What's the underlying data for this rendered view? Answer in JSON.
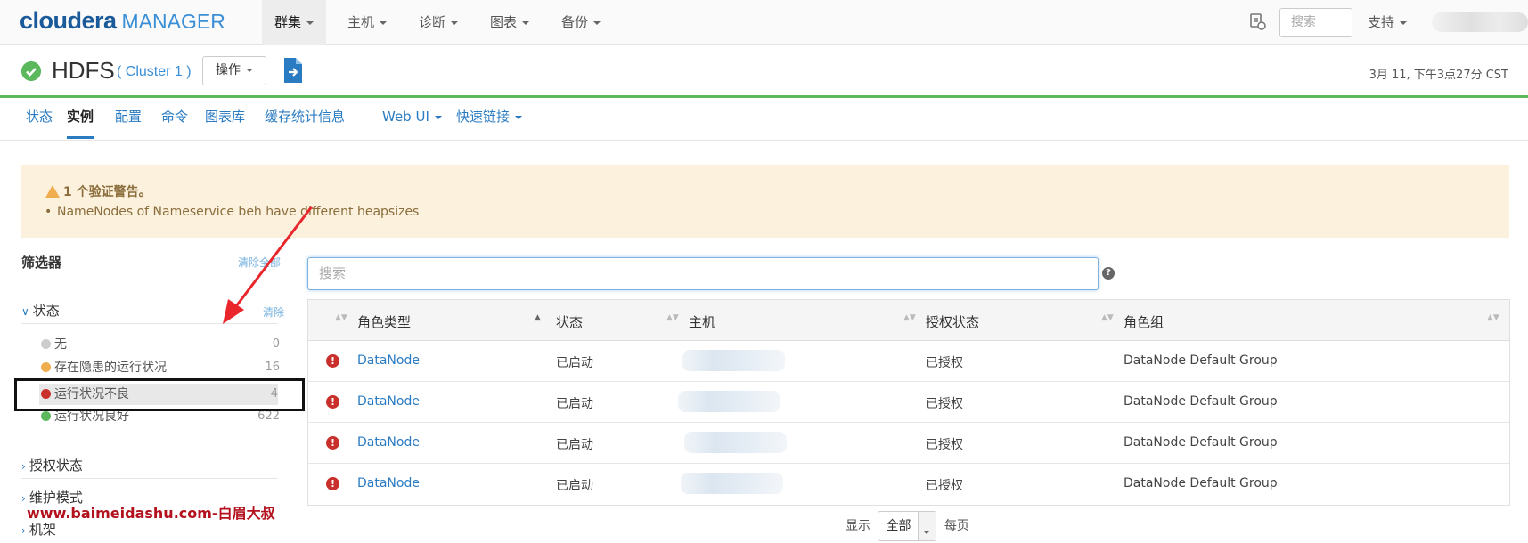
{
  "topnav": {
    "logo_main": "cloudera",
    "logo_sub": "MANAGER",
    "items": [
      {
        "label": "群集"
      },
      {
        "label": "主机"
      },
      {
        "label": "诊断"
      },
      {
        "label": "图表"
      },
      {
        "label": "备份"
      }
    ],
    "search_placeholder": "搜索",
    "support_label": "支持"
  },
  "service": {
    "name": "HDFS",
    "cluster": "( Cluster 1 )",
    "actions_label": "操作",
    "timestamp": "3月 11, 下午3点27分 CST",
    "status_color": "#5cb85c"
  },
  "subtabs": [
    {
      "label": "状态"
    },
    {
      "label": "实例",
      "active": true
    },
    {
      "label": "配置"
    },
    {
      "label": "命令"
    },
    {
      "label": "图表库"
    },
    {
      "label": "缓存统计信息"
    },
    {
      "label": "Web UI"
    },
    {
      "label": "快速链接"
    }
  ],
  "warning": {
    "title": "1 个验证警告。",
    "item": "NameNodes of Nameservice beh have different heapsizes"
  },
  "filters": {
    "title": "筛选器",
    "clear_all": "清除全部",
    "status_section": "状态",
    "clear": "清除",
    "items": [
      {
        "label": "无",
        "count": "0",
        "color": "#cccccc"
      },
      {
        "label": "存在隐患的运行状况",
        "count": "16",
        "color": "#f0ad4e"
      },
      {
        "label": "运行状况不良",
        "count": "4",
        "color": "#c9302c"
      },
      {
        "label": "运行状况良好",
        "count": "622",
        "color": "#5cb85c"
      }
    ],
    "sections": [
      "授权状态",
      "维护模式",
      "机架"
    ]
  },
  "table": {
    "search_placeholder": "搜索",
    "columns": [
      "角色类型",
      "状态",
      "主机",
      "授权状态",
      "角色组"
    ],
    "rows": [
      {
        "role": "DataNode",
        "state": "已启动",
        "auth": "已授权",
        "group": "DataNode Default Group"
      },
      {
        "role": "DataNode",
        "state": "已启动",
        "auth": "已授权",
        "group": "DataNode Default Group"
      },
      {
        "role": "DataNode",
        "state": "已启动",
        "auth": "已授权",
        "group": "DataNode Default Group"
      },
      {
        "role": "DataNode",
        "state": "已启动",
        "auth": "已授权",
        "group": "DataNode Default Group"
      }
    ]
  },
  "pager": {
    "show_label": "显示",
    "selected": "全部",
    "per_page_label": "每页"
  },
  "watermark": "www.baimeidashu.com-白眉大叔"
}
